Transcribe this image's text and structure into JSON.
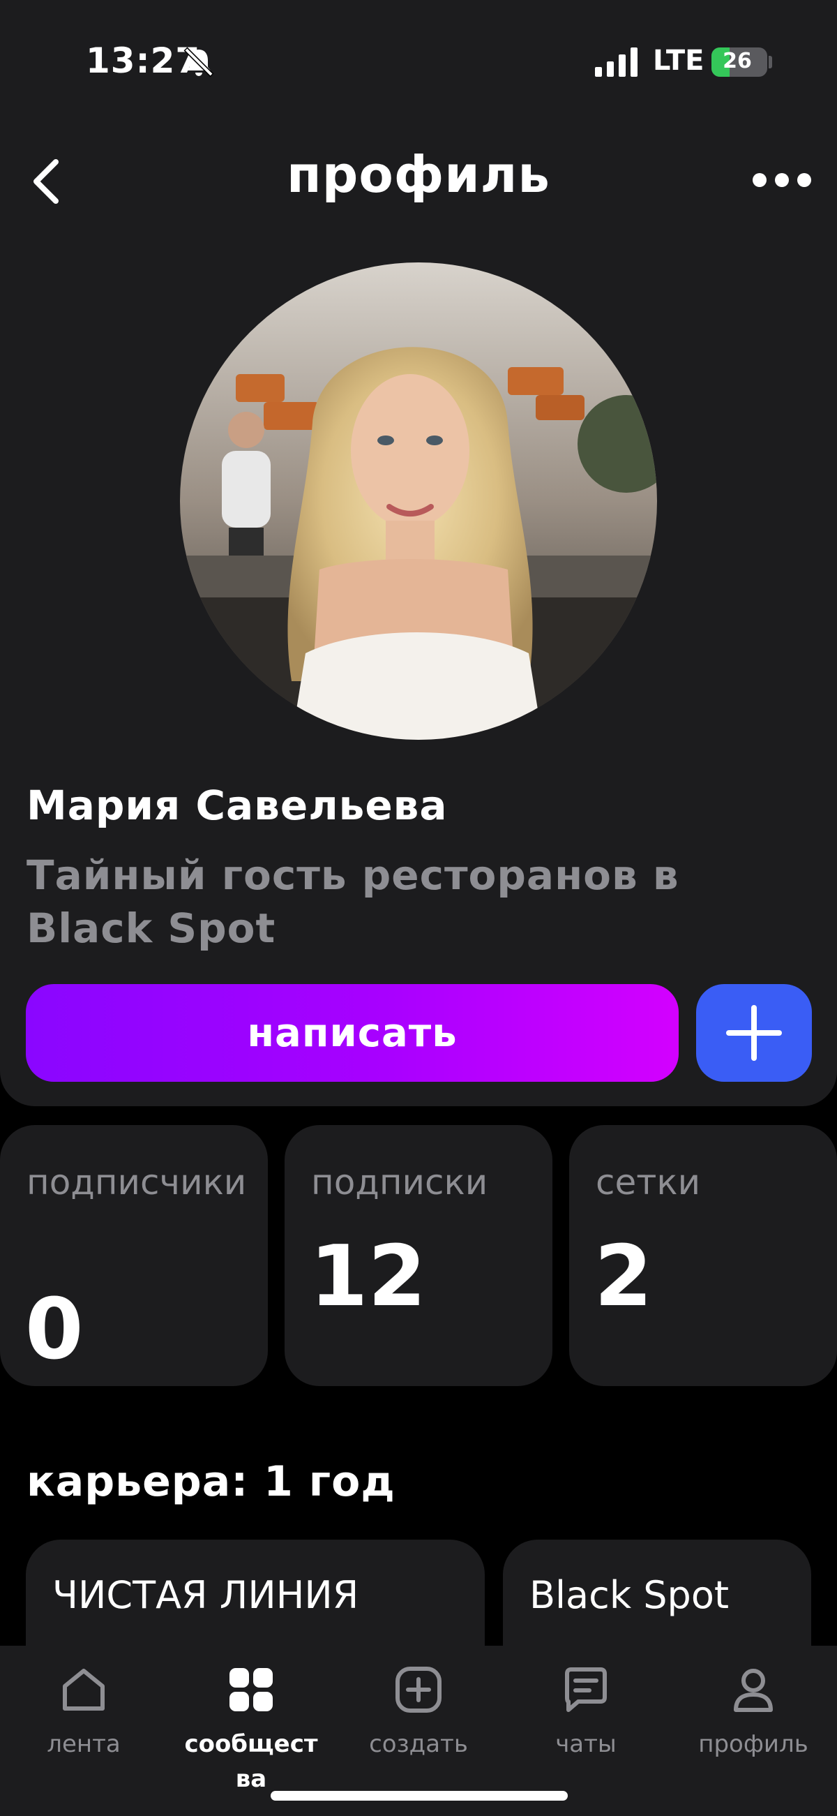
{
  "status_bar": {
    "time": "13:27",
    "network": "LTE",
    "battery_percent": "26"
  },
  "header": {
    "title": "профиль"
  },
  "profile": {
    "name": "Мария Савельева",
    "role": "Тайный гость ресторанов в Black Spot",
    "write_button": "написать"
  },
  "stats": [
    {
      "label": "подписчики",
      "value": "0"
    },
    {
      "label": "подписки",
      "value": "12"
    },
    {
      "label": "сетки",
      "value": "2"
    }
  ],
  "career": {
    "title": "карьера: 1 год",
    "places": [
      "ЧИСТАЯ ЛИНИЯ",
      "Black Spot"
    ]
  },
  "tabbar": {
    "items": [
      {
        "label": "лента",
        "icon": "home-icon"
      },
      {
        "label": "сообщества",
        "icon": "communities-icon",
        "active": true
      },
      {
        "label": "создать",
        "icon": "plus-square-icon"
      },
      {
        "label": "чаты",
        "icon": "chat-icon"
      },
      {
        "label": "профиль",
        "icon": "user-icon"
      }
    ]
  },
  "colors": {
    "accent_gradient_start": "#8a06ff",
    "accent_gradient_end": "#d300ff",
    "add_button": "#3a5df5",
    "background": "#000000",
    "card": "#1c1c1e"
  }
}
